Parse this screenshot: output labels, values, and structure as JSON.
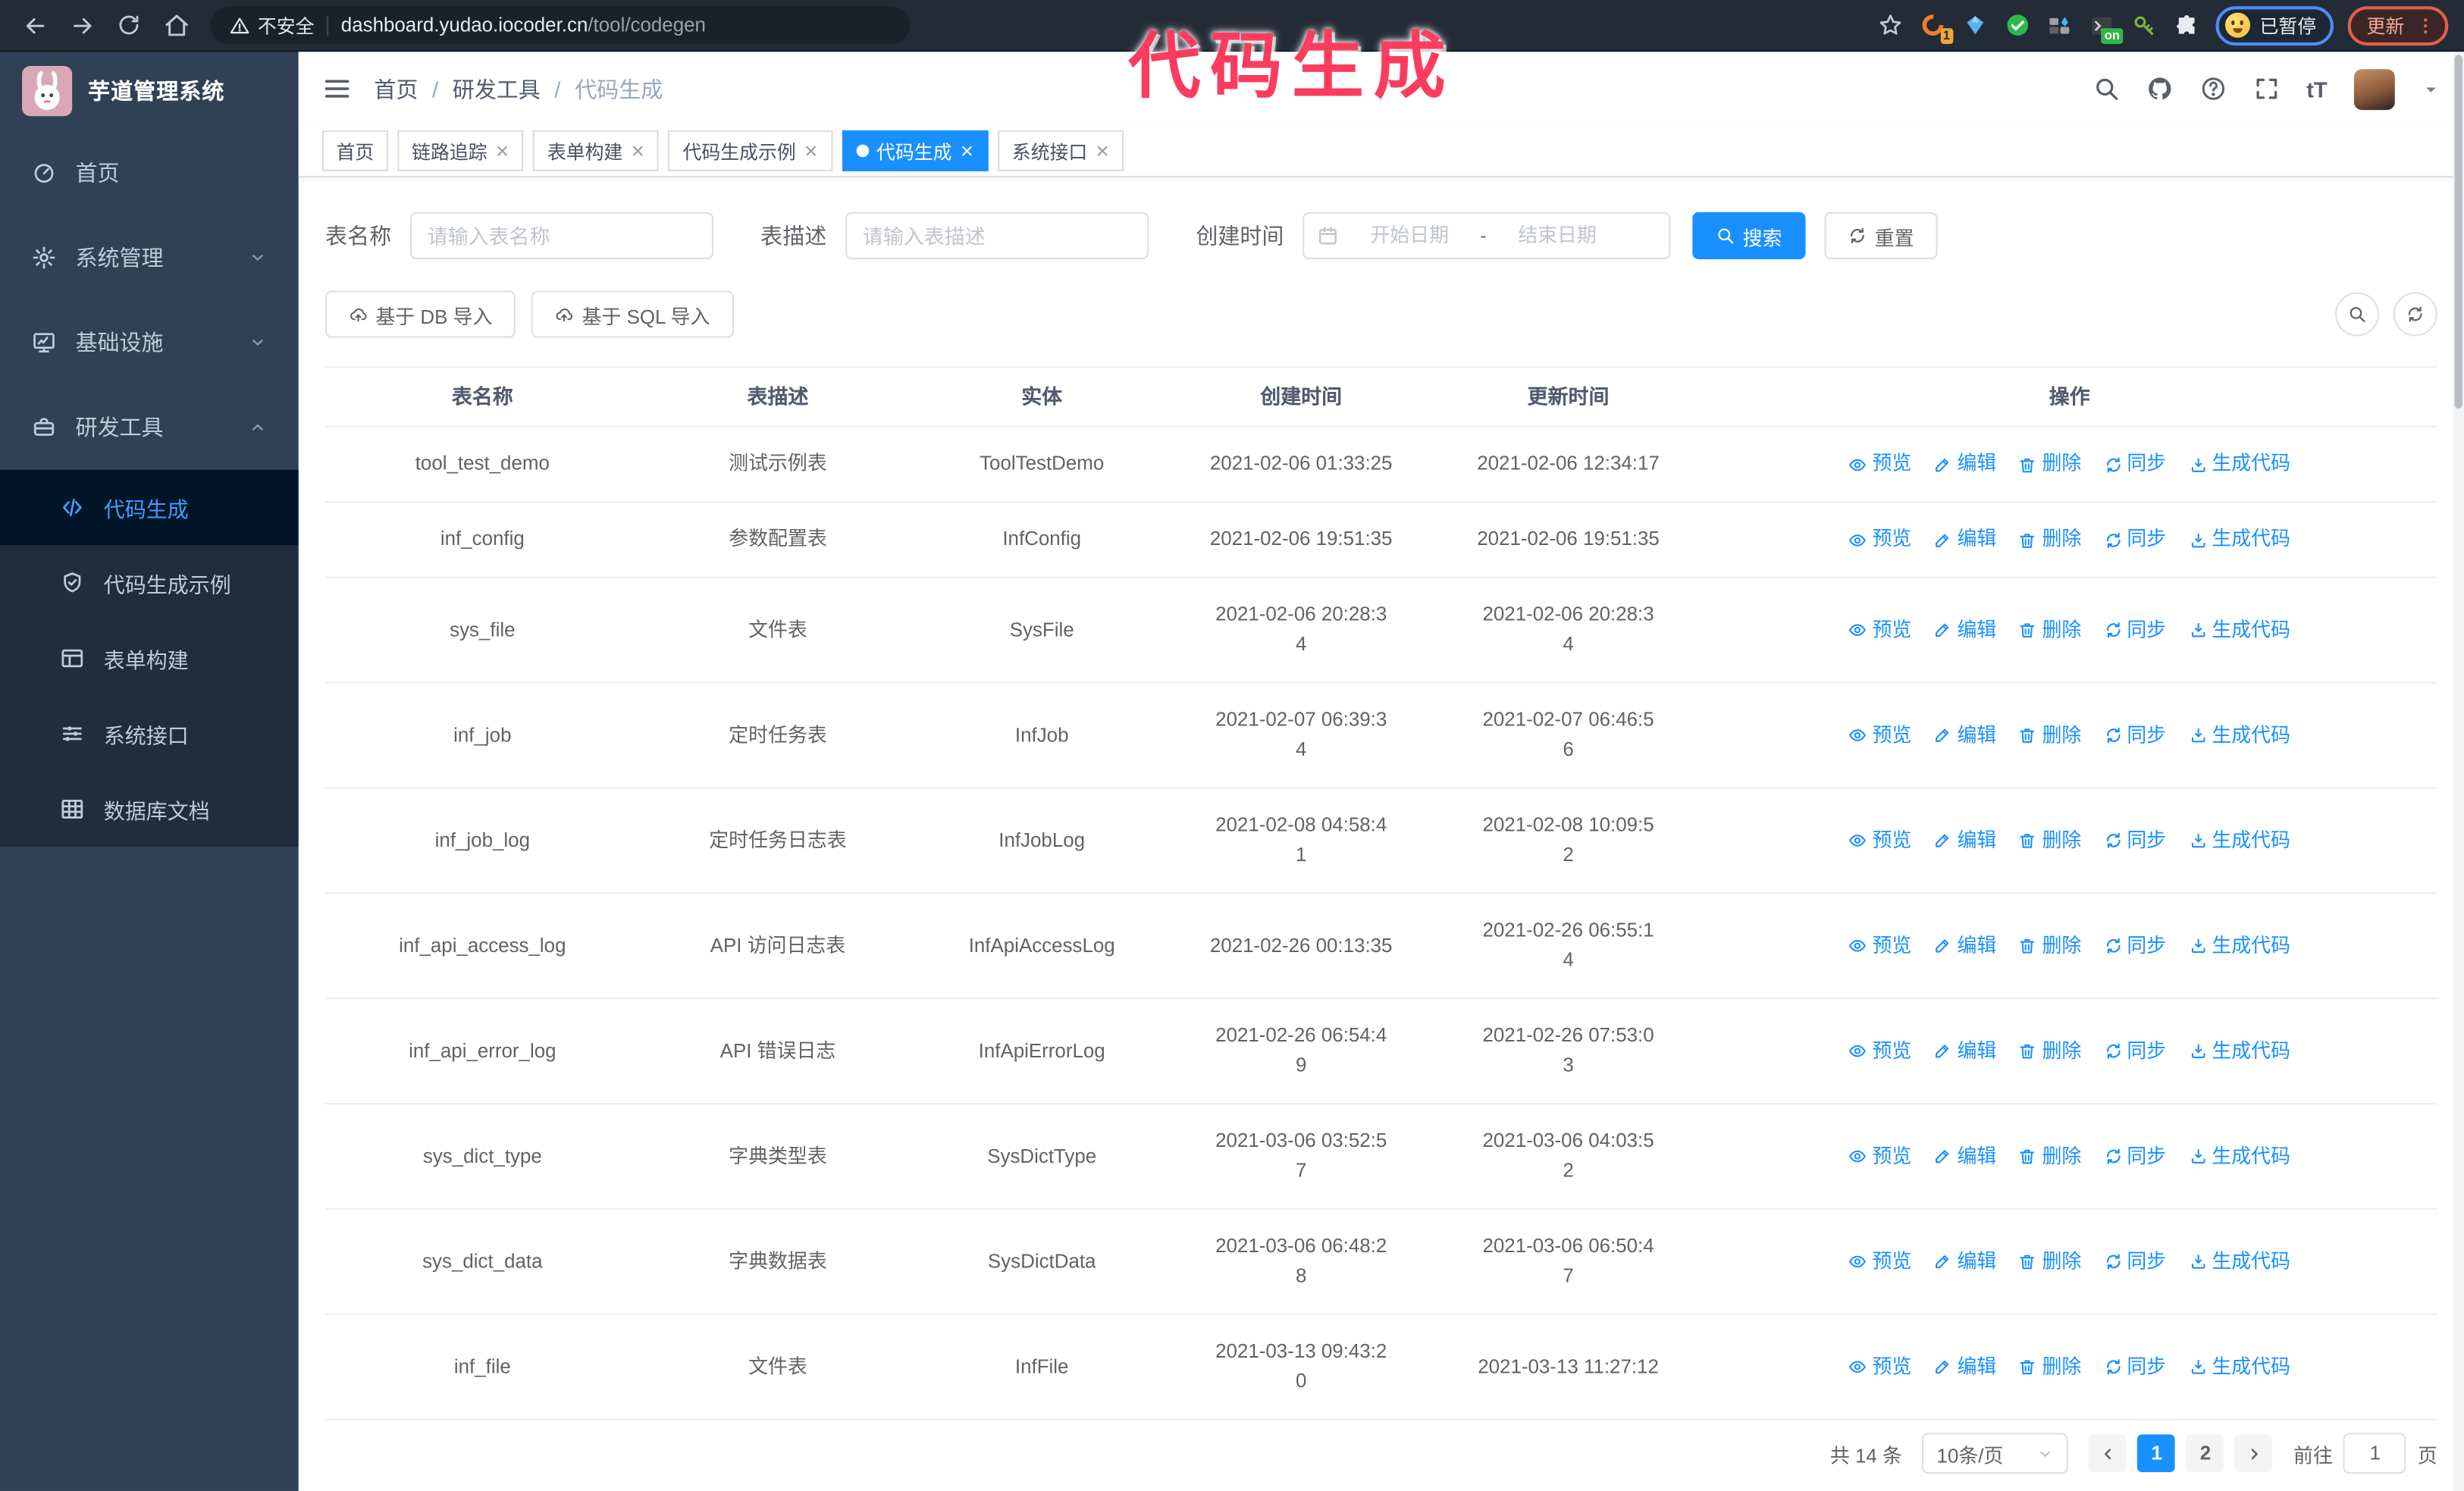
{
  "colors": {
    "primary": "#1890ff",
    "sidebar_bg": "#304156",
    "submenu_bg": "#1f2d3d",
    "active_item_bg": "#001528",
    "annotation": "#fb3c5f"
  },
  "annotation": {
    "text": "代码生成"
  },
  "browser": {
    "security": "不安全",
    "url_domain": "dashboard.yudao.iocoder.cn",
    "url_path": "/tool/codegen",
    "ext_badge_count": "1",
    "ext_badge_on": "on",
    "profile_chip": "已暂停",
    "update_button": "更新"
  },
  "app": {
    "logo_title": "芋道管理系统",
    "breadcrumb": [
      "首页",
      "研发工具",
      "代码生成"
    ],
    "breadcrumb_separator": "/",
    "font_size_glyph": "tT",
    "sidebar": {
      "items": [
        {
          "label": "首页"
        },
        {
          "label": "系统管理"
        },
        {
          "label": "基础设施"
        },
        {
          "label": "研发工具"
        }
      ],
      "subitems": [
        {
          "label": "代码生成"
        },
        {
          "label": "代码生成示例"
        },
        {
          "label": "表单构建"
        },
        {
          "label": "系统接口"
        },
        {
          "label": "数据库文档"
        }
      ]
    },
    "tabs": [
      {
        "label": "首页"
      },
      {
        "label": "链路追踪"
      },
      {
        "label": "表单构建"
      },
      {
        "label": "代码生成示例"
      },
      {
        "label": "代码生成"
      },
      {
        "label": "系统接口"
      }
    ]
  },
  "search": {
    "name_label": "表名称",
    "name_placeholder": "请输入表名称",
    "desc_label": "表描述",
    "desc_placeholder": "请输入表描述",
    "time_label": "创建时间",
    "start_placeholder": "开始日期",
    "separator": "-",
    "end_placeholder": "结束日期",
    "search_button": "搜索",
    "reset_button": "重置"
  },
  "toolbar": {
    "db_import": "基于 DB 导入",
    "sql_import": "基于 SQL 导入"
  },
  "table": {
    "columns": [
      "表名称",
      "表描述",
      "实体",
      "创建时间",
      "更新时间",
      "操作"
    ],
    "actions": [
      "预览",
      "编辑",
      "删除",
      "同步",
      "生成代码"
    ],
    "rows": [
      {
        "name": "tool_test_demo",
        "desc": "测试示例表",
        "entity": "ToolTestDemo",
        "created": "2021-02-06 01:33:25",
        "updated": "2021-02-06 12:34:17"
      },
      {
        "name": "inf_config",
        "desc": "参数配置表",
        "entity": "InfConfig",
        "created": "2021-02-06 19:51:35",
        "updated": "2021-02-06 19:51:35"
      },
      {
        "name": "sys_file",
        "desc": "文件表",
        "entity": "SysFile",
        "created": "2021-02-06 20:28:3\n4",
        "updated": "2021-02-06 20:28:3\n4"
      },
      {
        "name": "inf_job",
        "desc": "定时任务表",
        "entity": "InfJob",
        "created": "2021-02-07 06:39:3\n4",
        "updated": "2021-02-07 06:46:5\n6"
      },
      {
        "name": "inf_job_log",
        "desc": "定时任务日志表",
        "entity": "InfJobLog",
        "created": "2021-02-08 04:58:4\n1",
        "updated": "2021-02-08 10:09:5\n2"
      },
      {
        "name": "inf_api_access_log",
        "desc": "API 访问日志表",
        "entity": "InfApiAccessLog",
        "created": "2021-02-26 00:13:35",
        "updated": "2021-02-26 06:55:1\n4"
      },
      {
        "name": "inf_api_error_log",
        "desc": "API 错误日志",
        "entity": "InfApiErrorLog",
        "created": "2021-02-26 06:54:4\n9",
        "updated": "2021-02-26 07:53:0\n3"
      },
      {
        "name": "sys_dict_type",
        "desc": "字典类型表",
        "entity": "SysDictType",
        "created": "2021-03-06 03:52:5\n7",
        "updated": "2021-03-06 04:03:5\n2"
      },
      {
        "name": "sys_dict_data",
        "desc": "字典数据表",
        "entity": "SysDictData",
        "created": "2021-03-06 06:48:2\n8",
        "updated": "2021-03-06 06:50:4\n7"
      },
      {
        "name": "inf_file",
        "desc": "文件表",
        "entity": "InfFile",
        "created": "2021-03-13 09:43:2\n0",
        "updated": "2021-03-13 11:27:12"
      }
    ]
  },
  "pagination": {
    "total": "共 14 条",
    "page_size": "10条/页",
    "pages": [
      "1",
      "2"
    ],
    "goto_label": "前往",
    "goto_value": "1",
    "goto_suffix": "页"
  }
}
